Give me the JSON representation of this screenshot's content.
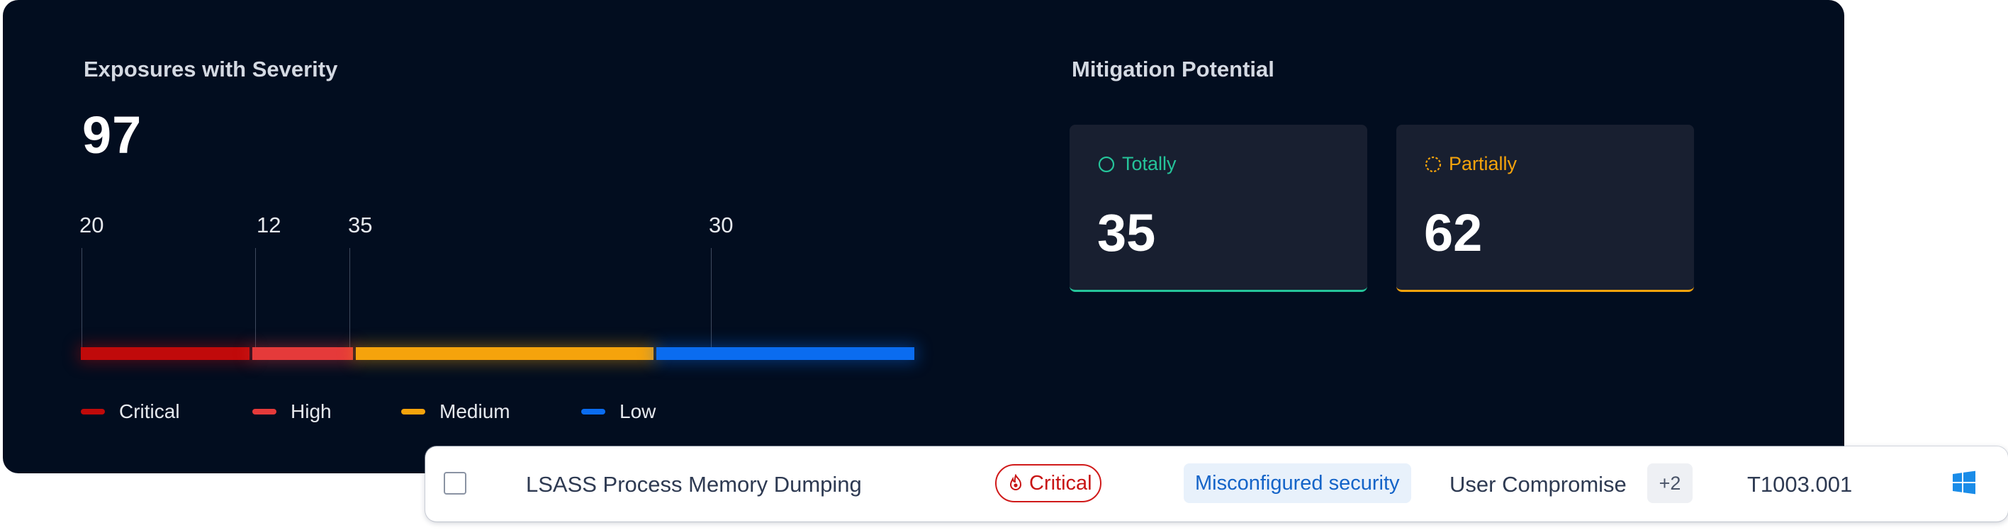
{
  "severity": {
    "title": "Exposures with Severity",
    "total": "97",
    "segments": [
      {
        "name": "Critical",
        "count": "20",
        "value": 20,
        "color": "#c00a0a"
      },
      {
        "name": "High",
        "count": "12",
        "value": 12,
        "color": "#e53a3a"
      },
      {
        "name": "Medium",
        "count": "35",
        "value": 35,
        "color": "#f5a30c"
      },
      {
        "name": "Low",
        "count": "30",
        "value": 30,
        "color": "#0a6cf0"
      }
    ]
  },
  "mitigation": {
    "title": "Mitigation Potential",
    "totally": {
      "label": "Totally",
      "value": "35",
      "color": "#25c49a"
    },
    "partially": {
      "label": "Partially",
      "value": "62",
      "color": "#f5a30c"
    }
  },
  "row": {
    "name": "LSASS Process Memory Dumping",
    "severity": "Critical",
    "tag": "Misconfigured security",
    "category": "User Compromise",
    "extra": "+2",
    "technique": "T1003.001",
    "os_icon": "windows-icon"
  }
}
